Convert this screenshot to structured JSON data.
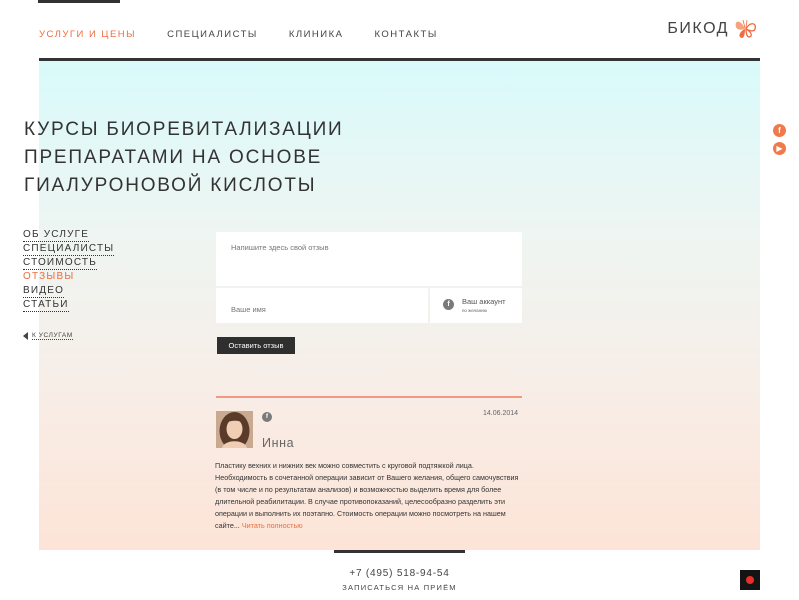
{
  "header": {
    "nav": [
      {
        "label": "Услуги и цены",
        "active": true
      },
      {
        "label": "Специалисты",
        "active": false
      },
      {
        "label": "Клиника",
        "active": false
      },
      {
        "label": "Контакты",
        "active": false
      }
    ],
    "logo_text": "БИКОД"
  },
  "page_title": "Курсы биоревитализации препаратами на основе гиалуроновой кислоты",
  "side_menu": {
    "items": [
      {
        "label": "Об услуге",
        "active": false
      },
      {
        "label": "Специалисты",
        "active": false
      },
      {
        "label": "Стоимость",
        "active": false
      },
      {
        "label": "Отзывы",
        "active": true
      },
      {
        "label": "Видео",
        "active": false
      },
      {
        "label": "Статьи",
        "active": false
      }
    ],
    "back_label": "к услугам"
  },
  "social": {
    "icons": [
      "facebook-icon",
      "youtube-icon"
    ]
  },
  "form": {
    "review_placeholder": "Напишите здесь свой отзыв",
    "name_placeholder": "Ваше имя",
    "account_label": "Ваш аккаунт",
    "account_sub": "по желанию",
    "submit_label": "Оставить отзыв"
  },
  "review": {
    "name": "Инна",
    "date": "14.06.2014",
    "text": "Пластику вехних и нижних век можно совместить с круговой подтяжкой лица. Необходимость в сочетанной операции зависит от Вашего желания, общего самочувствия (в том числе и по результатам анализов) и возможностью выделить время для более длительной реабилитации. В случае противопоказаний, целесообразно разделить эти операции и выполнить их поэтапно. Стоимость операции можно посмотреть на нашем сайте...",
    "more_label": "Читать полностью"
  },
  "footer": {
    "phone": "+7 (495) 518-94-54",
    "appointment": "Записаться на приём"
  },
  "colors": {
    "accent": "#ef6c3f",
    "dark": "#333333"
  }
}
